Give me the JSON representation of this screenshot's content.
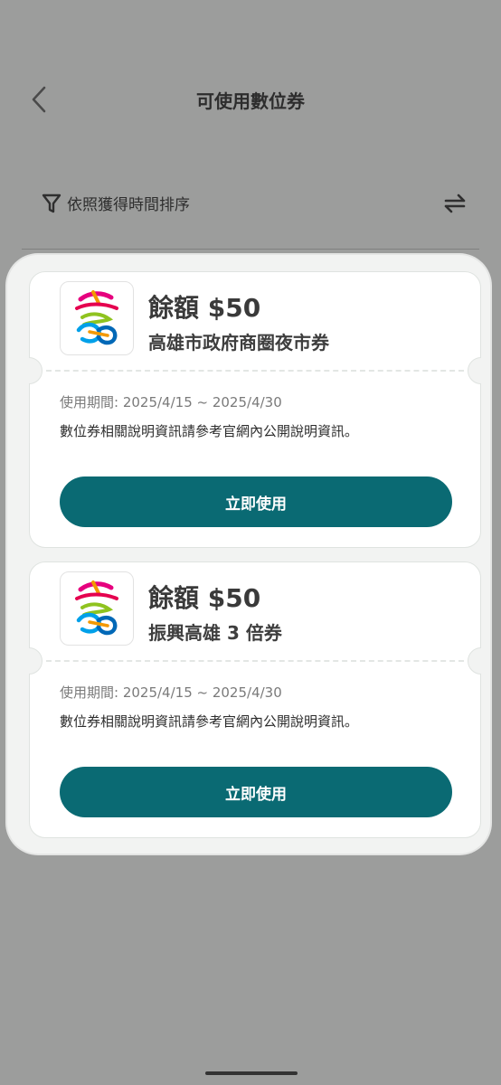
{
  "header": {
    "title": "可使用數位券"
  },
  "filter": {
    "sort_label": "依照獲得時間排序"
  },
  "vouchers": [
    {
      "balance": "餘額 $50",
      "name": "高雄市政府商圈夜市券",
      "period": "使用期間: 2025/4/15 ~ 2025/4/30",
      "description": "數位券相關說明資訊請參考官網內公開說明資訊。",
      "button_label": "立即使用"
    },
    {
      "balance": "餘額 $50",
      "name": "振興高雄 3 倍券",
      "period": "使用期間: 2025/4/15 ~ 2025/4/30",
      "description": "數位券相關說明資訊請參考官網內公開說明資訊。",
      "button_label": "立即使用"
    }
  ],
  "colors": {
    "background": "#9c9d9c",
    "sheet": "#f2f3f2",
    "button": "#0a6a73"
  },
  "icons": [
    "chevron-left-icon",
    "filter-icon",
    "swap-arrows-icon",
    "kaohsiung-logo-icon"
  ]
}
